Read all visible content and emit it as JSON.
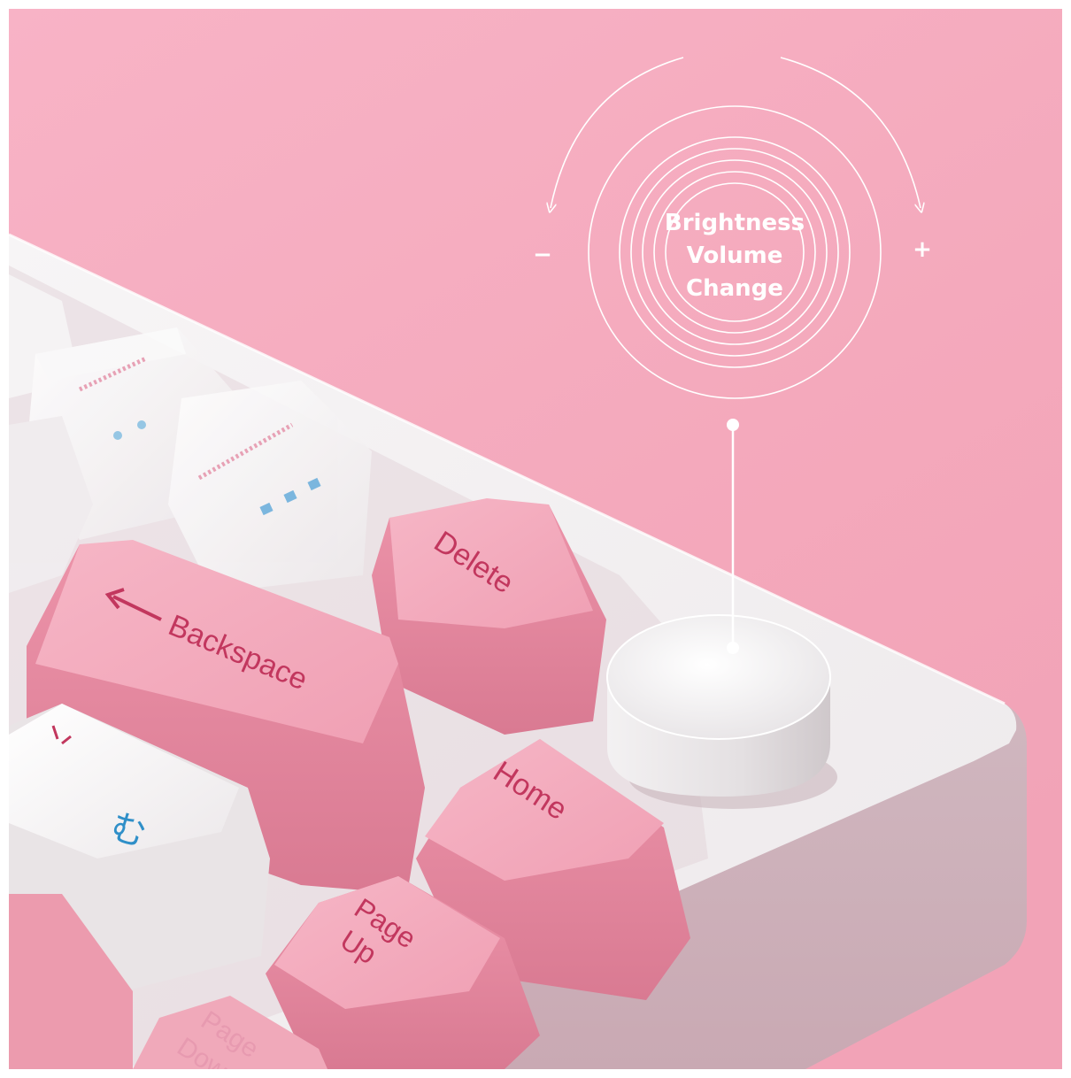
{
  "knob_callout": {
    "line1": "Brightness",
    "line2": "Volume",
    "line3": "Change",
    "minus_symbol": "−",
    "plus_symbol": "+"
  },
  "keycaps": {
    "delete": "Delete",
    "backspace": "Backspace",
    "home": "Home",
    "page_up_line1": "Page",
    "page_up_line2": "Up",
    "page_down_line1": "Page",
    "page_down_line2": "Down",
    "jp_glyph": "む"
  },
  "colors": {
    "background": "#f6b0c4",
    "keycap_pink": "#f3a8bb",
    "keycap_white": "#f4f2f3",
    "legend_pink": "#c2375e",
    "legend_blue": "#2f8fc8",
    "case_white": "#f2f0f1"
  }
}
